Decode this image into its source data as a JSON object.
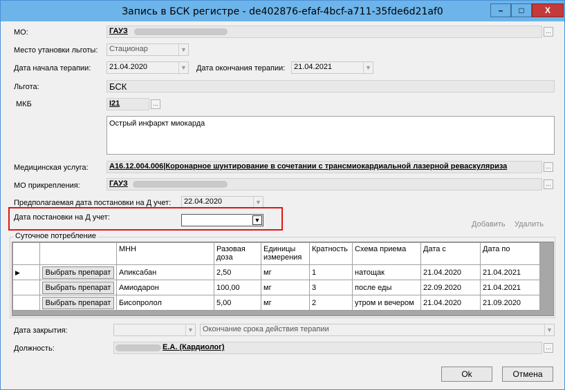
{
  "window": {
    "title": "Запись в БСК регистре - de402876-efaf-4bcf-a711-35fde6d21af0",
    "min_label": "–",
    "max_label": "□",
    "close_label": "X"
  },
  "form": {
    "mo": {
      "label": "МО:",
      "value": "ГАУЗ"
    },
    "install_place": {
      "label": "Место утановки льготы:",
      "value": "Стационар"
    },
    "therapy_start": {
      "label": "Дата начала терапии:",
      "value": "21.04.2020"
    },
    "therapy_end": {
      "label": "Дата окончания терапии:",
      "value": "21.04.2021"
    },
    "benefit": {
      "label": "Льгота:",
      "value": "БСК"
    },
    "mkb": {
      "label": "МКБ",
      "value": "I21",
      "description": "Острый инфаркт миокарда"
    },
    "med_service": {
      "label": "Медицинская услуга:",
      "value": "A16.12.004.006|Коронарное шунтирование в сочетании с трансмиокардиальной лазерной реваскуляриза"
    },
    "mo_attach": {
      "label": "МО прикрепления:",
      "value": "ГАУЗ"
    },
    "expected_d_date": {
      "label": "Предполагаемая дата постановки на Д учет:",
      "value": "22.04.2020"
    },
    "d_date": {
      "label": "Дата постановки на Д учет:",
      "value": ""
    },
    "add_label": "Добавить",
    "delete_label": "Удалить",
    "daily_group": "Суточное потребление",
    "close_date": {
      "label": "Дата закрытия:",
      "value": ""
    },
    "close_reason": {
      "value": "Окончание срока действия терапии"
    },
    "position": {
      "label": "Должность:",
      "value": "Е.А. (Кардиолог)"
    },
    "ok_label": "Ok",
    "cancel_label": "Отмена",
    "ellipsis": "...",
    "arrow": "▼"
  },
  "grid": {
    "columns": [
      "",
      "",
      "МНН",
      "Разовая доза",
      "Единицы измерения",
      "Кратность",
      "Схема приема",
      "Дата с",
      "Дата по"
    ],
    "button_label": "Выбрать препарат",
    "current_marker": "▶",
    "rows": [
      {
        "mnn": "Апиксабан",
        "dose": "2,50",
        "unit": "мг",
        "mult": "1",
        "scheme": "натощак",
        "from": "21.04.2020",
        "to": "21.04.2021"
      },
      {
        "mnn": "Амиодарон",
        "dose": "100,00",
        "unit": "мг",
        "mult": "3",
        "scheme": "после еды",
        "from": "22.09.2020",
        "to": "21.04.2021"
      },
      {
        "mnn": "Бисопролол",
        "dose": "5,00",
        "unit": "мг",
        "mult": "2",
        "scheme": "утром и вечером",
        "from": "21.04.2020",
        "to": "21.09.2020"
      }
    ]
  },
  "colors": {
    "titlebar": "#6cb4ea",
    "highlight": "#e01414",
    "close_button": "#c43a3a"
  }
}
